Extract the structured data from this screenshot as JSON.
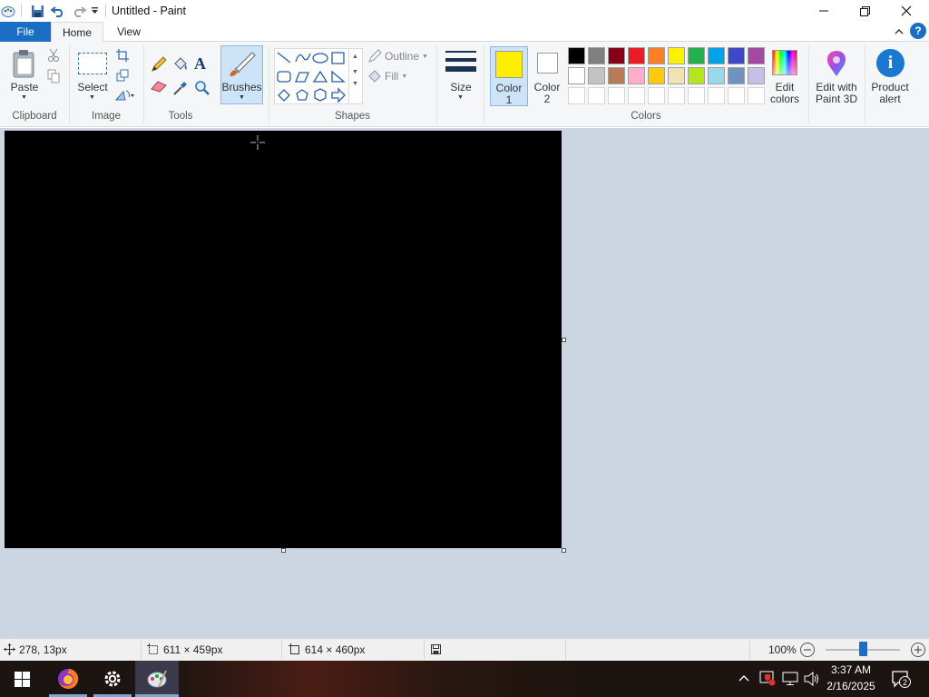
{
  "window": {
    "title": "Untitled - Paint"
  },
  "tabs": {
    "file": "File",
    "home": "Home",
    "view": "View"
  },
  "clipboard": {
    "paste": "Paste",
    "group": "Clipboard"
  },
  "image": {
    "select": "Select",
    "group": "Image"
  },
  "tools": {
    "group": "Tools"
  },
  "brushes": {
    "label": "Brushes"
  },
  "shapes": {
    "outline": "Outline",
    "fill": "Fill",
    "group": "Shapes"
  },
  "size": {
    "label": "Size"
  },
  "colors": {
    "color1_line1": "Color",
    "color1_line2": "1",
    "color2_line1": "Color",
    "color2_line2": "2",
    "color1": "#ffee00",
    "color2": "#ffffff",
    "group": "Colors",
    "edit_line1": "Edit",
    "edit_line2": "colors",
    "palette_row1": [
      "#000000",
      "#7f7f7f",
      "#880015",
      "#ed1c24",
      "#ff7f27",
      "#fff200",
      "#22b14c",
      "#00a2e8",
      "#3f48cc",
      "#a349a4"
    ],
    "palette_row2": [
      "#ffffff",
      "#c3c3c3",
      "#b97a57",
      "#ffaec9",
      "#ffc90e",
      "#efe4b0",
      "#b5e61d",
      "#99d9ea",
      "#7092be",
      "#c8bfe7"
    ]
  },
  "paint3d": {
    "line1": "Edit with",
    "line2": "Paint 3D"
  },
  "product_alert": {
    "line1": "Product",
    "line2": "alert"
  },
  "status": {
    "cursor_pos": "278, 13px",
    "selection_size": "611 × 459px",
    "image_size": "614 × 460px",
    "zoom": "100%",
    "zoom_level": 1.0
  },
  "taskbar": {
    "time": "3:37 AM",
    "date": "2/16/2025",
    "notification_count": "2"
  }
}
